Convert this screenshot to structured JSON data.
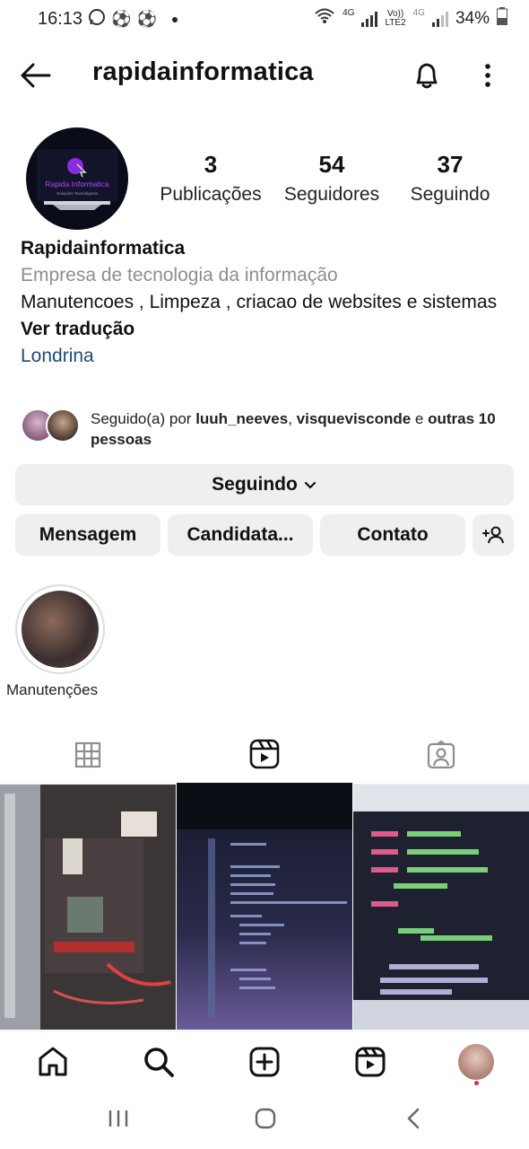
{
  "status": {
    "time": "16:13",
    "net_top": "4G",
    "volte_top": "Vo))",
    "volte_bottom": "LTE2",
    "net2_top": "4G",
    "battery": "34%"
  },
  "header": {
    "username": "rapidainformatica"
  },
  "stats": [
    {
      "value": "3",
      "label": "Publicações"
    },
    {
      "value": "54",
      "label": "Seguidores"
    },
    {
      "value": "37",
      "label": "Seguindo"
    }
  ],
  "avatar": {
    "brand": "Rapida Informatica",
    "tagline": "Soluções Tecnológicas"
  },
  "bio": {
    "name": "Rapidainformatica",
    "category": "Empresa de tecnologia da informação",
    "description": "Manutencoes , Limpeza , criacao de websites e sistemas",
    "translate": "Ver tradução",
    "location": "Londrina"
  },
  "followed_by": {
    "prefix": "Seguido(a) por ",
    "user1": "luuh_neeves",
    "sep": ", ",
    "user2": "visquevisconde",
    "and": " e ",
    "others": "outras 10 pessoas"
  },
  "buttons": {
    "following": "Seguindo",
    "message": "Mensagem",
    "apply": "Candidata...",
    "contact": "Contato"
  },
  "highlights": [
    {
      "label": "Manutenções"
    }
  ],
  "colors": {
    "accent_link": "#1d4a7a",
    "button_bg": "#efefef",
    "notification_dot": "#e0245e"
  }
}
